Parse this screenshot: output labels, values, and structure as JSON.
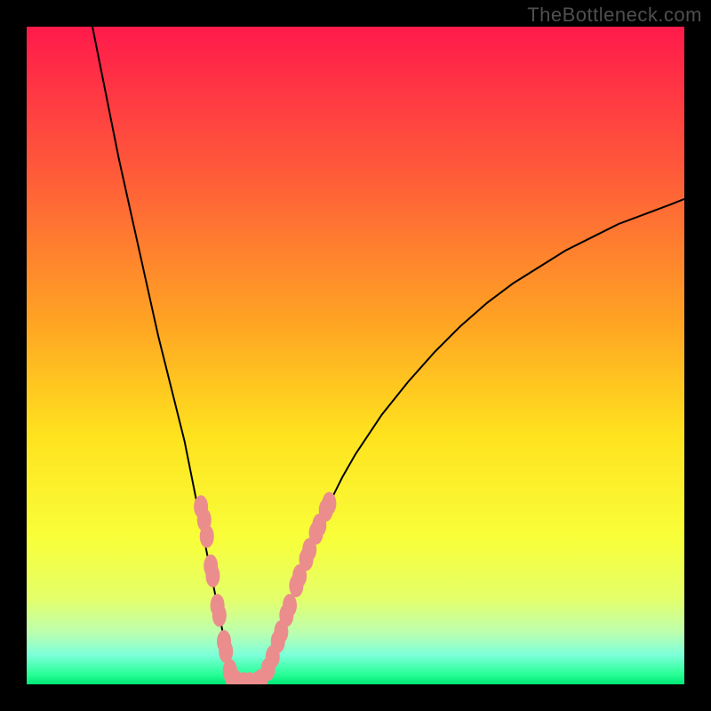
{
  "watermark": "TheBottleneck.com",
  "chart_data": {
    "type": "line",
    "title": "",
    "xlabel": "",
    "ylabel": "",
    "xlim": [
      0,
      100
    ],
    "ylim": [
      0,
      100
    ],
    "curve": {
      "x": [
        10,
        12,
        14,
        16,
        18,
        20,
        22,
        24,
        26,
        27,
        28,
        29,
        30,
        30.5,
        31,
        31.5,
        32,
        33,
        34,
        35,
        36,
        38,
        40,
        42,
        44,
        46,
        48,
        50,
        54,
        58,
        62,
        66,
        70,
        74,
        78,
        82,
        86,
        90,
        94,
        98,
        100
      ],
      "y": [
        100,
        90,
        80,
        71,
        62,
        53,
        45,
        37,
        27,
        22,
        17,
        12,
        7,
        4,
        2,
        0.6,
        0.1,
        0.1,
        0.1,
        0.2,
        1.0,
        6,
        12,
        18,
        23,
        27.5,
        31.5,
        35,
        41,
        46,
        50.5,
        54.5,
        58,
        61,
        63.5,
        66,
        68,
        70,
        71.5,
        73,
        73.8
      ]
    },
    "left_beads": [
      [
        26.5,
        27
      ],
      [
        27,
        25
      ],
      [
        27.4,
        22.5
      ],
      [
        28,
        18
      ],
      [
        28.3,
        16.5
      ],
      [
        29,
        12
      ],
      [
        29.3,
        10.5
      ],
      [
        30,
        6.5
      ],
      [
        30.3,
        5
      ],
      [
        30.9,
        2.1
      ],
      [
        31.1,
        1.4
      ],
      [
        31.6,
        0.6
      ],
      [
        32.1,
        0.15
      ],
      [
        33,
        0.1
      ],
      [
        33.9,
        0.1
      ]
    ],
    "right_beads": [
      [
        35.1,
        0.25
      ],
      [
        35.6,
        0.55
      ],
      [
        36.7,
        2.3
      ],
      [
        37.4,
        4.2
      ],
      [
        38.2,
        6.5
      ],
      [
        38.7,
        8
      ],
      [
        39.5,
        10.5
      ],
      [
        40,
        12
      ],
      [
        41,
        15
      ],
      [
        41.5,
        16.5
      ],
      [
        42.5,
        19
      ],
      [
        43,
        20.5
      ],
      [
        44,
        23
      ],
      [
        44.5,
        24.2
      ],
      [
        45.5,
        26.5
      ],
      [
        46,
        27.5
      ]
    ],
    "gradient_stops": [
      {
        "offset": 0.0,
        "color": "#ff1a4b"
      },
      {
        "offset": 0.22,
        "color": "#ff5a3a"
      },
      {
        "offset": 0.45,
        "color": "#ffa423"
      },
      {
        "offset": 0.62,
        "color": "#ffe21e"
      },
      {
        "offset": 0.78,
        "color": "#f8ff3a"
      },
      {
        "offset": 0.87,
        "color": "#e4ff6a"
      },
      {
        "offset": 0.92,
        "color": "#beffae"
      },
      {
        "offset": 0.955,
        "color": "#7dffd9"
      },
      {
        "offset": 0.985,
        "color": "#28ff96"
      },
      {
        "offset": 1.0,
        "color": "#00e676"
      }
    ],
    "colors": {
      "curve": "#000000",
      "bead": "#eb8d8d",
      "frame": "#000000"
    }
  }
}
